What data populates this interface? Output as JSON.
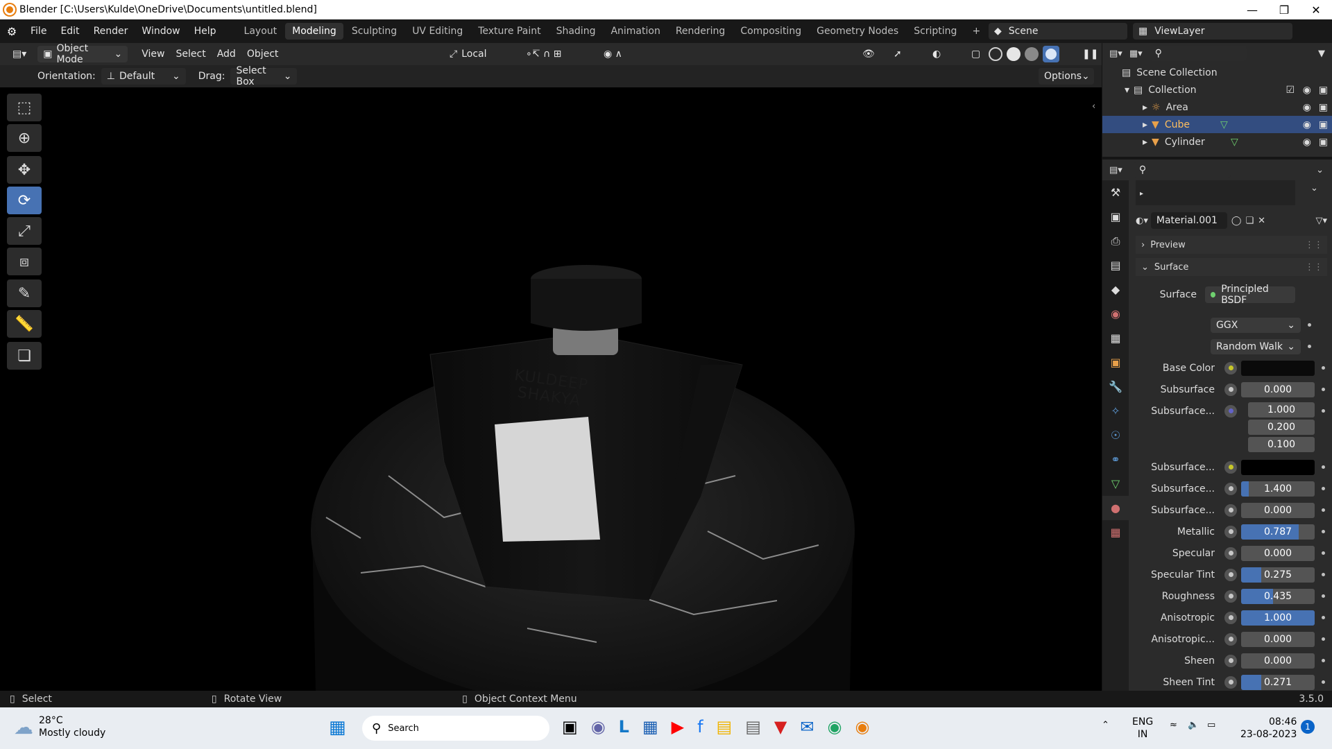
{
  "window": {
    "title": "Blender [C:\\Users\\Kulde\\OneDrive\\Documents\\untitled.blend]"
  },
  "menubar": {
    "menus": [
      "File",
      "Edit",
      "Render",
      "Window",
      "Help"
    ],
    "workspaces": [
      "Layout",
      "Modeling",
      "Sculpting",
      "UV Editing",
      "Texture Paint",
      "Shading",
      "Animation",
      "Rendering",
      "Compositing",
      "Geometry Nodes",
      "Scripting"
    ],
    "active_workspace": "Modeling",
    "scene": "Scene",
    "view_layer": "ViewLayer"
  },
  "header": {
    "mode": "Object Mode",
    "menus": [
      "View",
      "Select",
      "Add",
      "Object"
    ],
    "pivot": "Local"
  },
  "tool_settings": {
    "orientation_label": "Orientation:",
    "orientation": "Default",
    "drag_label": "Drag:",
    "drag": "Select Box",
    "options": "Options"
  },
  "viewport": {
    "label_line1": "KULDEEP",
    "label_line2": "SHAKYA"
  },
  "outliner": {
    "root": "Scene Collection",
    "collection": "Collection",
    "objects": [
      "Area",
      "Cube",
      "Cylinder"
    ],
    "selected": "Cube"
  },
  "properties": {
    "material": "Material.001",
    "panels": {
      "preview": "Preview",
      "surface": "Surface"
    },
    "surface_label": "Surface",
    "surface_shader": "Principled BSDF",
    "distribution": "GGX",
    "subsurface_method": "Random Walk",
    "rows": [
      {
        "label": "Base Color",
        "type": "color",
        "color": "#0a0a0a"
      },
      {
        "label": "Subsurface",
        "value": "0.000",
        "fill": 0
      },
      {
        "label": "Subsurface...",
        "value": "1.000",
        "fill": 0,
        "vector": [
          "1.000",
          "0.200",
          "0.100"
        ]
      },
      {
        "label": "Subsurface...",
        "type": "color",
        "color": "#000000"
      },
      {
        "label": "Subsurface...",
        "value": "1.400",
        "fill": 0.1
      },
      {
        "label": "Subsurface...",
        "value": "0.000",
        "fill": 0
      },
      {
        "label": "Metallic",
        "value": "0.787",
        "fill": 0.787
      },
      {
        "label": "Specular",
        "value": "0.000",
        "fill": 0
      },
      {
        "label": "Specular Tint",
        "value": "0.275",
        "fill": 0.275
      },
      {
        "label": "Roughness",
        "value": "0.435",
        "fill": 0.435
      },
      {
        "label": "Anisotropic",
        "value": "1.000",
        "fill": 1
      },
      {
        "label": "Anisotropic...",
        "value": "0.000",
        "fill": 0
      },
      {
        "label": "Sheen",
        "value": "0.000",
        "fill": 0
      },
      {
        "label": "Sheen Tint",
        "value": "0.271",
        "fill": 0.271
      }
    ]
  },
  "statusbar": {
    "select": "Select",
    "rotate": "Rotate View",
    "context": "Object Context Menu",
    "version": "3.5.0"
  },
  "taskbar": {
    "weather_temp": "28°C",
    "weather_desc": "Mostly cloudy",
    "search": "Search",
    "lang1": "ENG",
    "lang2": "IN",
    "time": "08:46",
    "date": "23-08-2023",
    "notif": "1"
  },
  "colors": {
    "accent": "#4772b3",
    "selection": "#334d80",
    "orange": "#e87d0d"
  }
}
